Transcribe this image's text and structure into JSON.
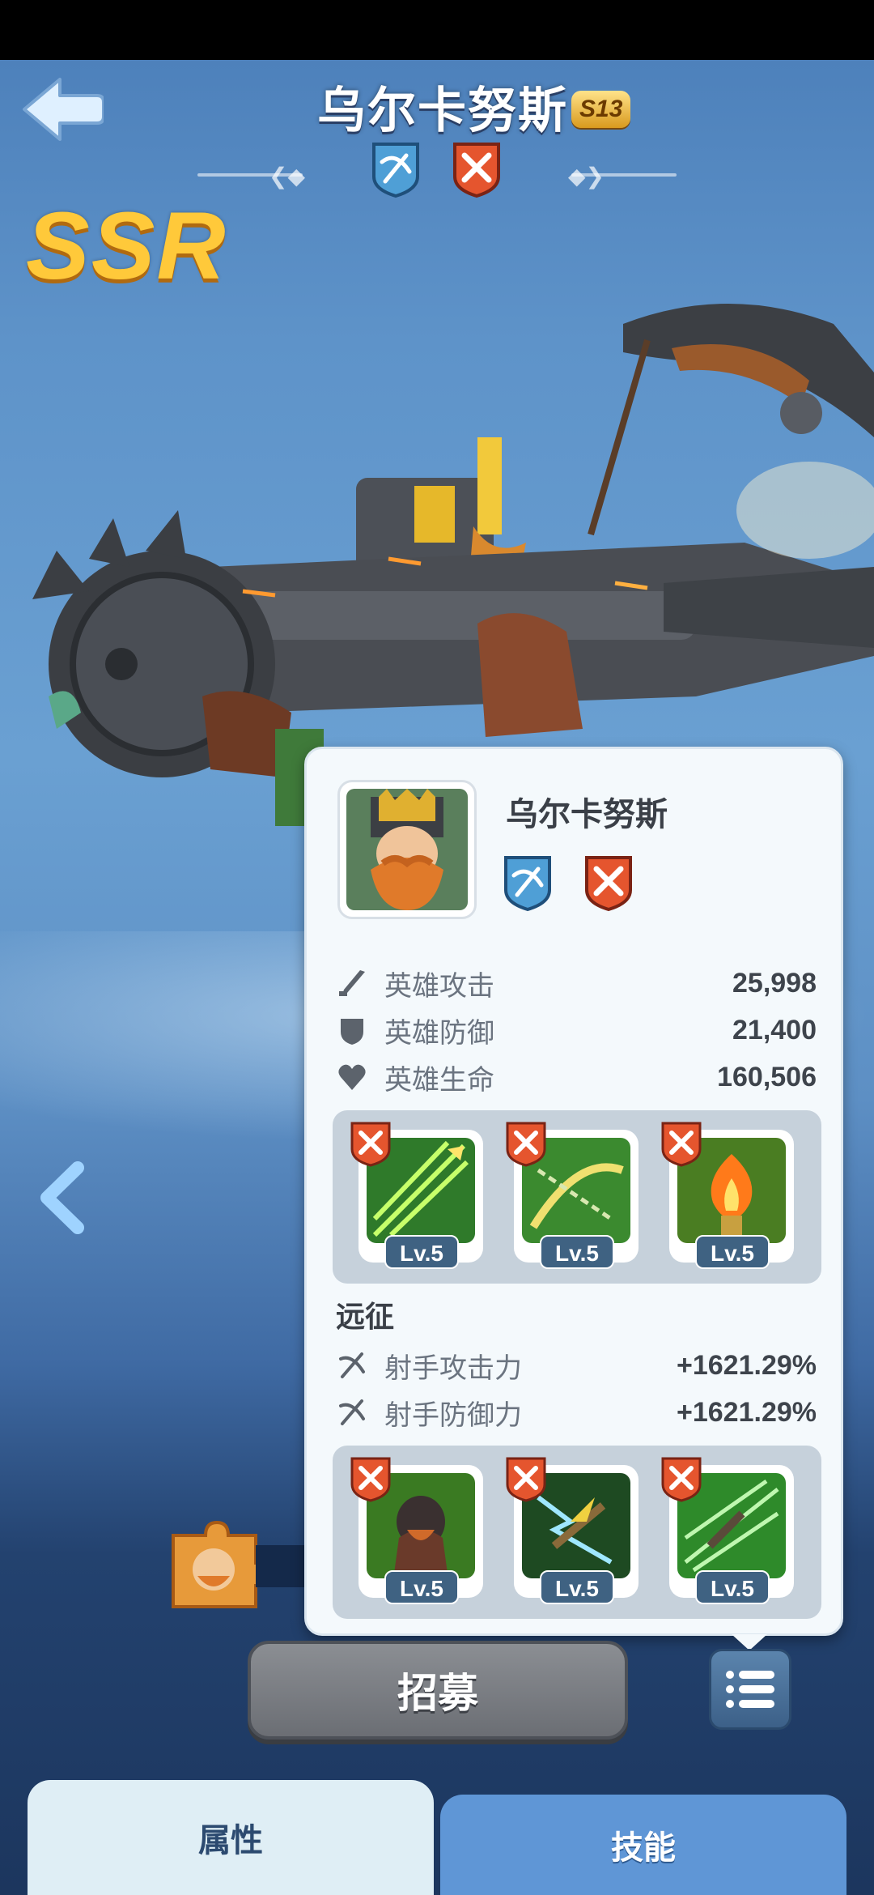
{
  "hero": {
    "name": "乌尔卡努斯",
    "star_badge": "S13",
    "rarity": "SSR",
    "class_icons": [
      "crossbow-class-icon",
      "warrior-class-icon"
    ]
  },
  "popup": {
    "name": "乌尔卡努斯",
    "stats": [
      {
        "icon": "sword-icon",
        "label": "英雄攻击",
        "value": "25,998"
      },
      {
        "icon": "shield-icon",
        "label": "英雄防御",
        "value": "21,400"
      },
      {
        "icon": "heart-icon",
        "label": "英雄生命",
        "value": "160,506"
      }
    ],
    "skills_top": [
      {
        "name": "arrows-skill-icon",
        "level": "Lv.5"
      },
      {
        "name": "chain-crossbow-skill-icon",
        "level": "Lv.5"
      },
      {
        "name": "fire-brazier-skill-icon",
        "level": "Lv.5"
      }
    ],
    "expedition_title": "远征",
    "expedition_stats": [
      {
        "icon": "crossbow-icon",
        "label": "射手攻击力",
        "value": "+1621.29%"
      },
      {
        "icon": "crossbow-icon",
        "label": "射手防御力",
        "value": "+1621.29%"
      }
    ],
    "skills_bottom": [
      {
        "name": "dwarf-warrior-skill-icon",
        "level": "Lv.5"
      },
      {
        "name": "lightning-crossbow-skill-icon",
        "level": "Lv.5"
      },
      {
        "name": "triple-bolt-skill-icon",
        "level": "Lv.5"
      }
    ]
  },
  "buttons": {
    "recruit": "招募"
  },
  "tabs": {
    "attributes": "属性",
    "skills": "技能"
  },
  "colors": {
    "rarity": "#ffc93a",
    "tab_active": "#5f96d6",
    "lv_tag": "#3f6282"
  }
}
